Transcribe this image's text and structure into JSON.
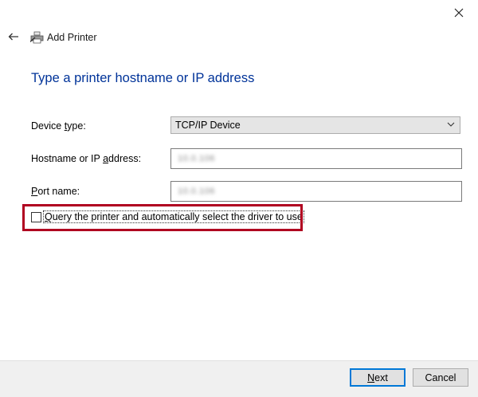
{
  "window": {
    "title": "Add Printer"
  },
  "page": {
    "heading": "Type a printer hostname or IP address"
  },
  "form": {
    "device_type_label_prefix": "Device ",
    "device_type_label_accel": "t",
    "device_type_label_suffix": "ype:",
    "device_type_value": "TCP/IP Device",
    "hostname_label_prefix": "Hostname or IP ",
    "hostname_label_accel": "a",
    "hostname_label_suffix": "ddress:",
    "hostname_value": "10.0.106",
    "port_label_accel": "P",
    "port_label_suffix": "ort name:",
    "port_value": "10.0.106",
    "query_accel": "Q",
    "query_label_suffix": "uery the printer and automatically select the driver to use",
    "query_checked": false
  },
  "buttons": {
    "next_accel": "N",
    "next_suffix": "ext",
    "cancel_label": "Cancel"
  },
  "colors": {
    "heading": "#003399",
    "highlight_border": "#b00020",
    "primary_border": "#0078d7"
  },
  "icons": [
    "close-icon",
    "back-arrow-icon",
    "printer-icon",
    "chevron-down-icon"
  ]
}
